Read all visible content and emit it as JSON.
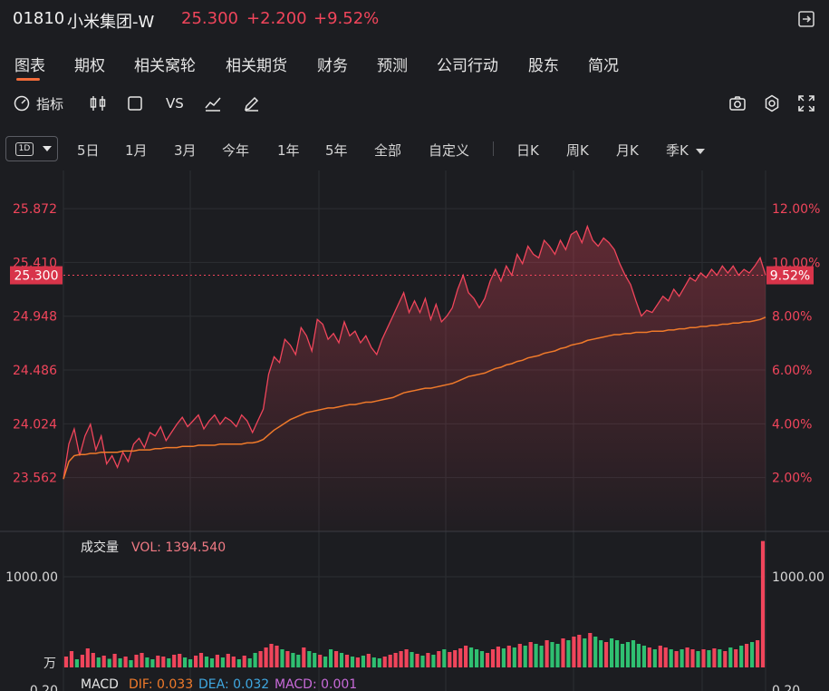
{
  "header": {
    "code": "01810",
    "name": "小米集团-W",
    "price": "25.300",
    "change": "+2.200",
    "change_pct": "+9.52%"
  },
  "icons": {
    "exit": "exit-fullscreen-icon",
    "indicator": "gauge-icon",
    "candles": "candlestick-icon",
    "square": "square-icon",
    "draw": "drawing-icon",
    "pen": "pencil-icon",
    "camera": "camera-icon",
    "settings": "gear-icon",
    "expand": "expand-icon"
  },
  "tabs": [
    "图表",
    "期权",
    "相关窝轮",
    "相关期货",
    "财务",
    "预测",
    "公司行动",
    "股东",
    "简况"
  ],
  "active_tab": "图表",
  "toolbar": {
    "indicator_label": "指标",
    "vs_label": "VS"
  },
  "ranges": {
    "selected": "1D",
    "items": [
      "5日",
      "1月",
      "3月",
      "今年",
      "1年",
      "5年",
      "全部",
      "自定义"
    ],
    "kline_items": [
      "日K",
      "周K",
      "月K"
    ],
    "season_label": "季K"
  },
  "colors": {
    "up": "#f0455b",
    "avg_line": "#f07a2a",
    "down": "#2fbf71",
    "grid": "#2c2e33",
    "background": "#1c1d21"
  },
  "chart_data": [
    {
      "type": "line",
      "title": "",
      "y_ticks_left": [
        "25.872",
        "25.410",
        "24.948",
        "24.486",
        "24.024",
        "23.562"
      ],
      "y_ticks_right": [
        "12.00%",
        "10.00%",
        "8.00%",
        "6.00%",
        "4.00%",
        "2.00%"
      ],
      "ylim": [
        23.1,
        26.2
      ],
      "current_price_label": "25.300",
      "current_pct_label": "9.52%",
      "series": [
        {
          "values": [
            23.55,
            23.85,
            23.98,
            23.75,
            23.92,
            24.02,
            23.8,
            23.92,
            23.68,
            23.75,
            23.65,
            23.78,
            23.7,
            23.85,
            23.9,
            23.82,
            23.95,
            23.92,
            24.0,
            23.88,
            23.95,
            24.02,
            24.08,
            24.0,
            24.05,
            24.1,
            23.98,
            24.05,
            24.1,
            24.02,
            24.08,
            24.05,
            24.0,
            24.1,
            24.05,
            23.95,
            24.05,
            24.15,
            24.45,
            24.6,
            24.55,
            24.75,
            24.7,
            24.62,
            24.85,
            24.78,
            24.65,
            24.92,
            24.88,
            24.75,
            24.8,
            24.72,
            24.9,
            24.78,
            24.82,
            24.72,
            24.78,
            24.68,
            24.62,
            24.75,
            24.85,
            24.95,
            25.05,
            25.15,
            24.98,
            25.08,
            24.98,
            25.1,
            24.92,
            25.05,
            24.9,
            24.95,
            25.02,
            25.18,
            25.3,
            25.15,
            25.1,
            25.02,
            25.1,
            25.25,
            25.35,
            25.25,
            25.38,
            25.3,
            25.48,
            25.4,
            25.55,
            25.48,
            25.45,
            25.6,
            25.55,
            25.48,
            25.6,
            25.52,
            25.65,
            25.68,
            25.58,
            25.72,
            25.6,
            25.55,
            25.62,
            25.58,
            25.52,
            25.4,
            25.3,
            25.22,
            25.08,
            24.95,
            25.0,
            24.98,
            25.05,
            25.12,
            25.08,
            25.18,
            25.12,
            25.2,
            25.28,
            25.25,
            25.32,
            25.28,
            25.35,
            25.3,
            25.38,
            25.32,
            25.38,
            25.3,
            25.35,
            25.32,
            25.38,
            25.45,
            25.3
          ]
        },
        {
          "values": [
            23.55,
            23.7,
            23.75,
            23.76,
            23.76,
            23.77,
            23.77,
            23.78,
            23.78,
            23.78,
            23.78,
            23.79,
            23.79,
            23.79,
            23.8,
            23.8,
            23.8,
            23.81,
            23.81,
            23.82,
            23.82,
            23.82,
            23.83,
            23.83,
            23.83,
            23.84,
            23.84,
            23.84,
            23.84,
            23.85,
            23.85,
            23.85,
            23.85,
            23.85,
            23.86,
            23.86,
            23.87,
            23.89,
            23.93,
            23.97,
            24.0,
            24.03,
            24.06,
            24.08,
            24.1,
            24.12,
            24.13,
            24.14,
            24.15,
            24.16,
            24.16,
            24.17,
            24.18,
            24.19,
            24.19,
            24.2,
            24.21,
            24.21,
            24.22,
            24.23,
            24.24,
            24.25,
            24.27,
            24.29,
            24.3,
            24.31,
            24.32,
            24.33,
            24.33,
            24.34,
            24.35,
            24.36,
            24.37,
            24.39,
            24.41,
            24.43,
            24.44,
            24.45,
            24.46,
            24.48,
            24.5,
            24.51,
            24.53,
            24.54,
            24.56,
            24.57,
            24.59,
            24.6,
            24.61,
            24.63,
            24.64,
            24.65,
            24.67,
            24.68,
            24.7,
            24.71,
            24.72,
            24.74,
            24.75,
            24.76,
            24.77,
            24.78,
            24.79,
            24.79,
            24.8,
            24.8,
            24.81,
            24.81,
            24.81,
            24.82,
            24.82,
            24.82,
            24.83,
            24.83,
            24.84,
            24.84,
            24.85,
            24.85,
            24.86,
            24.86,
            24.87,
            24.87,
            24.88,
            24.88,
            24.89,
            24.89,
            24.9,
            24.9,
            24.91,
            24.92,
            24.94
          ]
        }
      ]
    },
    {
      "type": "bar",
      "title": "成交量",
      "vol_label": "VOL: 1394.540",
      "y_ticks": [
        "1000.00",
        "1000.00"
      ],
      "unit_label": "万",
      "ylim": [
        0,
        1400
      ],
      "values": [
        120,
        180,
        90,
        140,
        210,
        160,
        110,
        130,
        95,
        150,
        100,
        120,
        80,
        140,
        160,
        110,
        90,
        130,
        120,
        100,
        140,
        150,
        110,
        90,
        130,
        160,
        120,
        100,
        140,
        110,
        150,
        120,
        90,
        130,
        100,
        160,
        180,
        220,
        260,
        240,
        200,
        180,
        160,
        140,
        220,
        180,
        160,
        140,
        120,
        200,
        180,
        160,
        140,
        120,
        110,
        130,
        150,
        110,
        100,
        120,
        140,
        160,
        180,
        200,
        170,
        150,
        130,
        160,
        140,
        180,
        200,
        170,
        190,
        210,
        240,
        220,
        200,
        180,
        160,
        200,
        230,
        210,
        240,
        220,
        260,
        240,
        280,
        260,
        240,
        300,
        280,
        260,
        320,
        300,
        340,
        360,
        320,
        380,
        340,
        300,
        280,
        320,
        300,
        260,
        280,
        300,
        260,
        240,
        220,
        200,
        240,
        220,
        200,
        180,
        200,
        220,
        200,
        180,
        200,
        190,
        210,
        200,
        180,
        220,
        200,
        240,
        260,
        280,
        300,
        1394
      ],
      "colors": [
        "up",
        "up",
        "down",
        "up",
        "up",
        "up",
        "down",
        "up",
        "down",
        "up",
        "down",
        "up",
        "down",
        "up",
        "up",
        "down",
        "down",
        "up",
        "up",
        "down",
        "up",
        "up",
        "down",
        "down",
        "up",
        "up",
        "down",
        "down",
        "up",
        "down",
        "up",
        "up",
        "down",
        "up",
        "down",
        "down",
        "up",
        "up",
        "up",
        "up",
        "down",
        "up",
        "down",
        "down",
        "up",
        "down",
        "down",
        "up",
        "down",
        "down",
        "up",
        "down",
        "up",
        "down",
        "up",
        "down",
        "up",
        "down",
        "down",
        "up",
        "up",
        "up",
        "up",
        "up",
        "down",
        "up",
        "down",
        "up",
        "down",
        "up",
        "down",
        "up",
        "up",
        "up",
        "up",
        "down",
        "down",
        "down",
        "up",
        "up",
        "up",
        "down",
        "up",
        "down",
        "up",
        "down",
        "up",
        "down",
        "down",
        "up",
        "down",
        "down",
        "up",
        "down",
        "up",
        "up",
        "down",
        "up",
        "down",
        "down",
        "up",
        "down",
        "down",
        "down",
        "down",
        "down",
        "down",
        "down",
        "up",
        "down",
        "up",
        "up",
        "down",
        "up",
        "down",
        "up",
        "up",
        "down",
        "up",
        "down",
        "up",
        "down",
        "up",
        "down",
        "up",
        "down",
        "up",
        "down",
        "up",
        "up",
        "up",
        "up"
      ]
    },
    {
      "type": "line",
      "title": "MACD",
      "dif_label": "DIF: 0.033",
      "dea_label": "DEA: 0.032",
      "macd_label": "MACD: 0.001",
      "y_tick": "0.20"
    }
  ]
}
